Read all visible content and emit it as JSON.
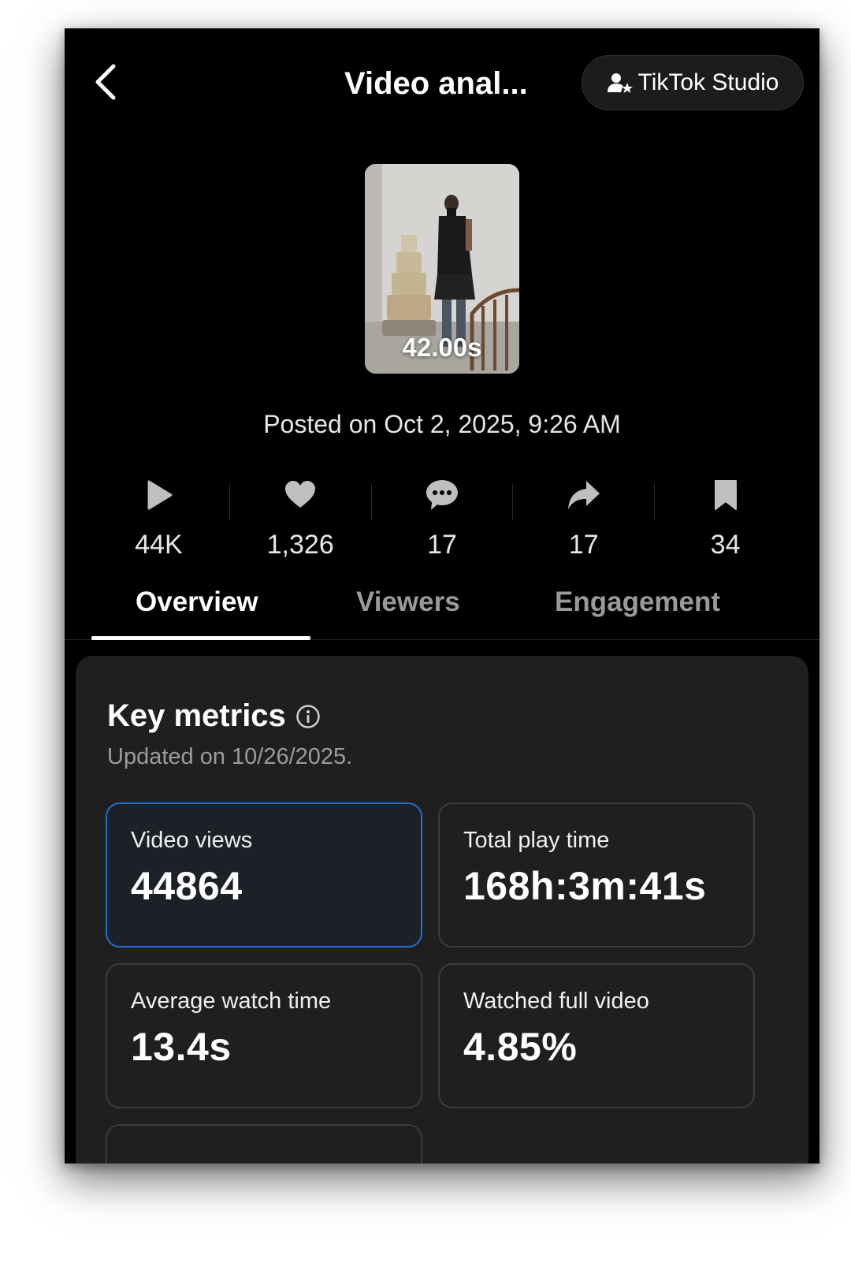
{
  "header": {
    "title": "Video anal...",
    "studio_button_label": "TikTok Studio"
  },
  "video": {
    "duration": "42.00s",
    "posted_on": "Posted on Oct 2, 2025, 9:26 AM"
  },
  "stats": [
    {
      "icon": "play-icon",
      "value": "44K"
    },
    {
      "icon": "heart-icon",
      "value": "1,326"
    },
    {
      "icon": "comment-icon",
      "value": "17"
    },
    {
      "icon": "share-icon",
      "value": "17"
    },
    {
      "icon": "bookmark-icon",
      "value": "34"
    }
  ],
  "tabs": [
    {
      "label": "Overview",
      "active": true
    },
    {
      "label": "Viewers",
      "active": false
    },
    {
      "label": "Engagement",
      "active": false
    }
  ],
  "key_metrics": {
    "title": "Key metrics",
    "updated": "Updated on 10/26/2025.",
    "tiles": [
      {
        "label": "Video views",
        "value": "44864",
        "selected": true
      },
      {
        "label": "Total play time",
        "value": "168h:3m:41s",
        "selected": false
      },
      {
        "label": "Average watch time",
        "value": "13.4s",
        "selected": false
      },
      {
        "label": "Watched full video",
        "value": "4.85%",
        "selected": false
      }
    ]
  },
  "colors": {
    "background": "#000000",
    "card": "#1f1f1f",
    "accent_border": "#1f6fd1",
    "tile_border": "#3c3c3c",
    "muted_text": "#9a9a9a"
  }
}
